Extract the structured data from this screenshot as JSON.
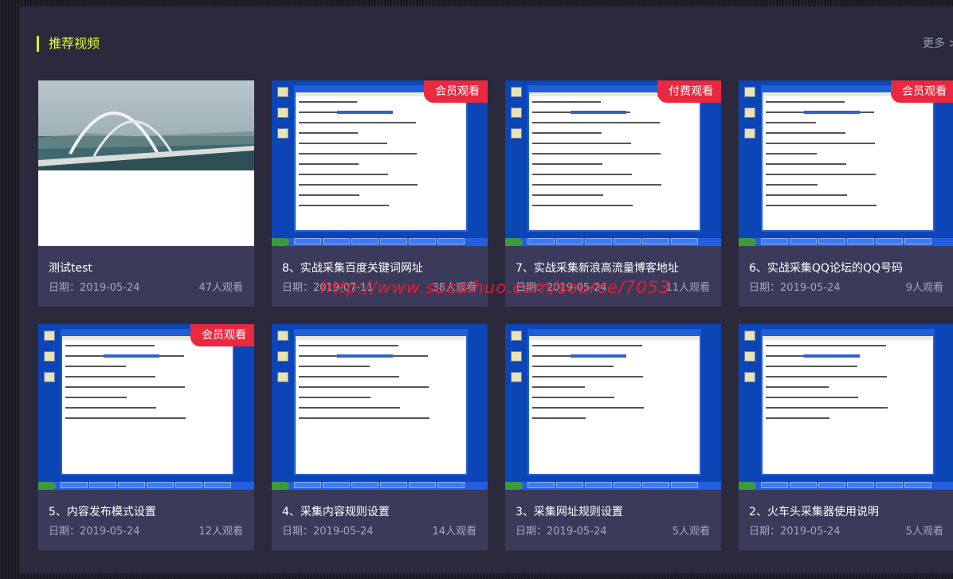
{
  "section": {
    "title": "推荐视频",
    "more": "更多 >"
  },
  "date_prefix": "日期：",
  "watermark": "http://www.sucaihuo.com/source/7053",
  "videos": [
    {
      "title": "测试test",
      "date": "2019-05-24",
      "views": "47人观看",
      "badge": "",
      "thumb": "bridge"
    },
    {
      "title": "8、实战采集百度关键词网址",
      "date": "2019-07-11",
      "views": "38人观看",
      "badge": "会员观看",
      "thumb": "screen"
    },
    {
      "title": "7、实战采集新浪高流量博客地址",
      "date": "2019-05-24",
      "views": "11人观看",
      "badge": "付费观看",
      "thumb": "screen"
    },
    {
      "title": "6、实战采集QQ论坛的QQ号码",
      "date": "2019-05-24",
      "views": "9人观看",
      "badge": "会员观看",
      "thumb": "screen"
    },
    {
      "title": "5、内容发布模式设置",
      "date": "2019-05-24",
      "views": "12人观看",
      "badge": "会员观看",
      "thumb": "screen"
    },
    {
      "title": "4、采集内容规则设置",
      "date": "2019-05-24",
      "views": "14人观看",
      "badge": "",
      "thumb": "screen"
    },
    {
      "title": "3、采集网址规则设置",
      "date": "2019-05-24",
      "views": "5人观看",
      "badge": "",
      "thumb": "screen"
    },
    {
      "title": "2、火车头采集器使用说明",
      "date": "2019-05-24",
      "views": "5人观看",
      "badge": "",
      "thumb": "screen"
    }
  ],
  "colors": {
    "accent": "#e0ff3a",
    "badge": "#e8293f",
    "card": "#3c3a5a",
    "panel": "#2b2a3d"
  }
}
